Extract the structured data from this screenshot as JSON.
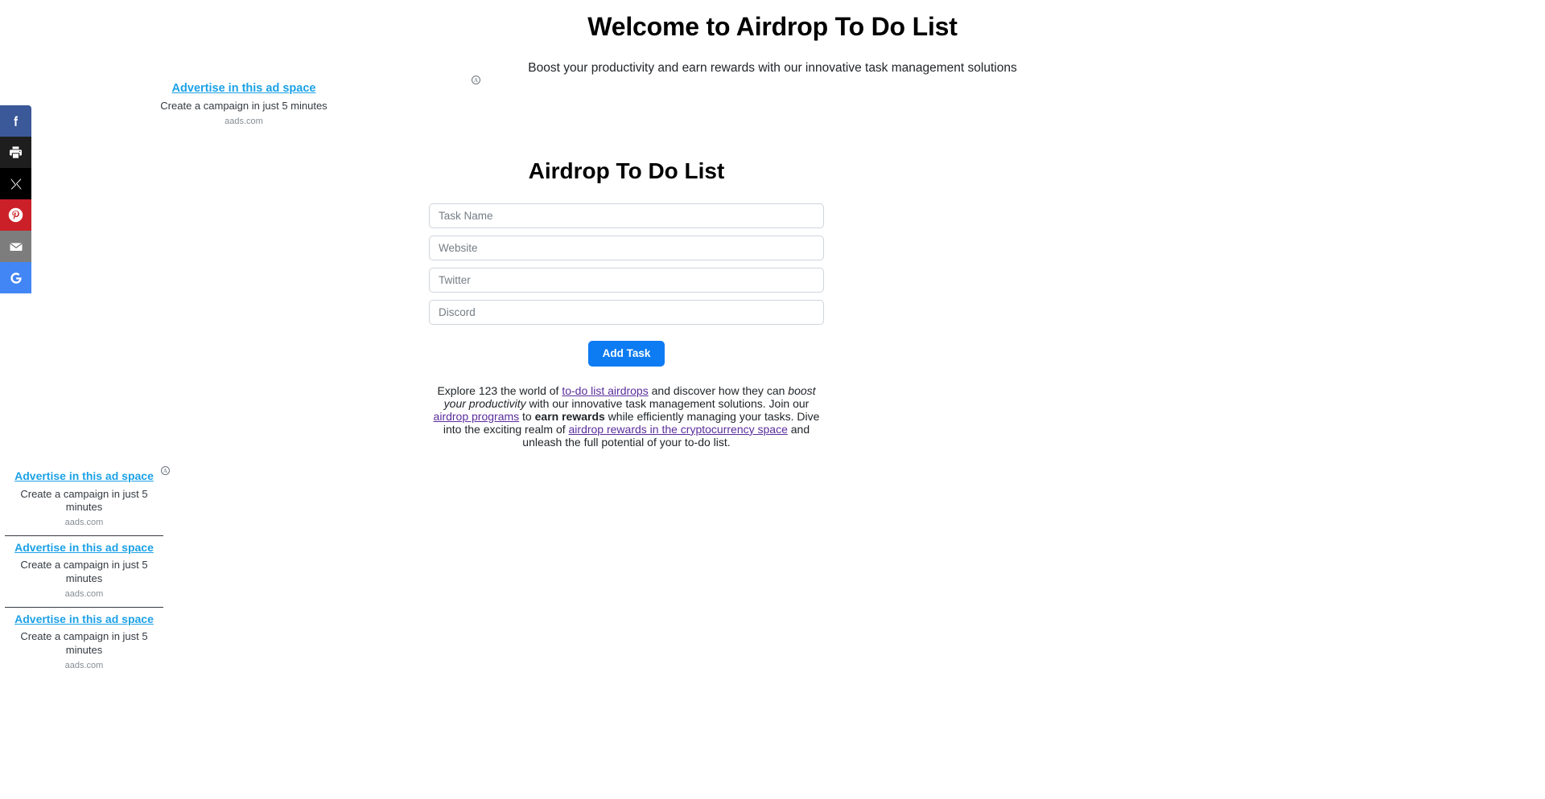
{
  "hero": {
    "title": "Welcome to Airdrop To Do List",
    "subtitle": "Boost your productivity and earn rewards with our innovative task management solutions",
    "badge_glyph": "A"
  },
  "ads": {
    "top": {
      "title": "Advertise in this ad space",
      "description": "Create a campaign in just 5 minutes",
      "source": "aads.com"
    },
    "rail_badge_glyph": "A",
    "rail": [
      {
        "title": "Advertise in this ad space",
        "description": "Create a campaign in just 5 minutes",
        "source": "aads.com"
      },
      {
        "title": "Advertise in this ad space",
        "description": "Create a campaign in just 5 minutes",
        "source": "aads.com"
      },
      {
        "title": "Advertise in this ad space",
        "description": "Create a campaign in just 5 minutes",
        "source": "aads.com"
      }
    ]
  },
  "share_rail": {
    "buttons": [
      {
        "name": "facebook",
        "label": "Share on Facebook",
        "color": "#3b5998"
      },
      {
        "name": "print",
        "label": "Print",
        "color": "#1e1e1e"
      },
      {
        "name": "x",
        "label": "Share on X",
        "color": "#000000"
      },
      {
        "name": "pinterest",
        "label": "Pin it",
        "color": "#cb2027"
      },
      {
        "name": "email",
        "label": "Share by Email",
        "color": "#7d7d7d"
      },
      {
        "name": "google",
        "label": "Share on Google",
        "color": "#4285f4"
      }
    ]
  },
  "todo": {
    "title": "Airdrop To Do List",
    "fields": {
      "task_name_placeholder": "Task Name",
      "website_placeholder": "Website",
      "twitter_placeholder": "Twitter",
      "discord_placeholder": "Discord",
      "task_name_value": "",
      "website_value": "",
      "twitter_value": "",
      "discord_value": ""
    },
    "add_button_label": "Add Task"
  },
  "seo": {
    "p1": "Explore 123 the world of ",
    "link1": "to-do list airdrops",
    "p2": " and discover how they can ",
    "em1": "boost your productivity",
    "p3": " with our innovative task management solutions. Join our ",
    "link2": "airdrop programs",
    "p4": " to ",
    "strong1": "earn rewards",
    "p5": " while efficiently managing your tasks. Dive into the exciting realm of ",
    "link3": "airdrop rewards in the cryptocurrency space",
    "p6": " and unleash the full potential of your to-do list."
  },
  "colors": {
    "accent_blue": "#0d7bf2",
    "ad_link_blue": "#1ba1e6",
    "seo_link_purple": "#5a2d9c"
  }
}
